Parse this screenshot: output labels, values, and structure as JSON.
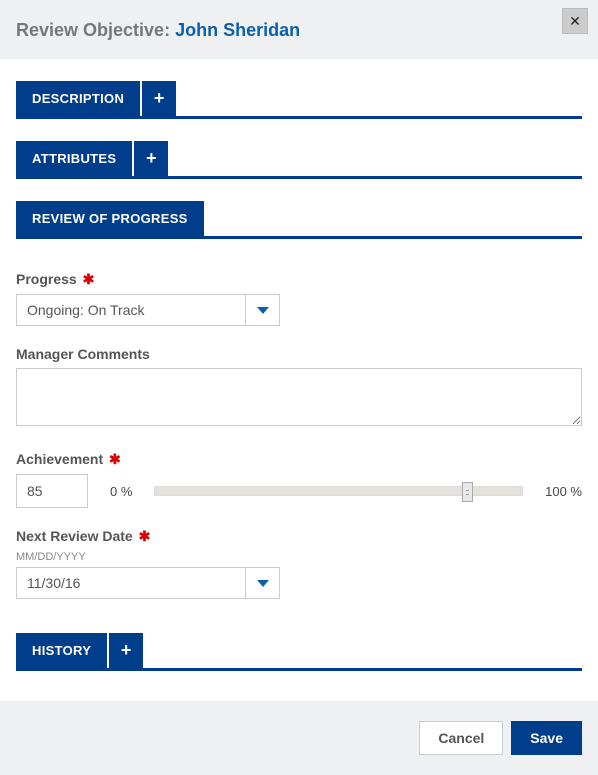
{
  "header": {
    "title_prefix": "Review Objective: ",
    "title_link": "John Sheridan"
  },
  "sections": {
    "description_label": "DESCRIPTION",
    "attributes_label": "ATTRIBUTES",
    "review_label": "REVIEW OF PROGRESS",
    "history_label": "HISTORY"
  },
  "form": {
    "progress_label": "Progress",
    "progress_value": "Ongoing: On Track",
    "manager_comments_label": "Manager Comments",
    "manager_comments_value": "",
    "achievement_label": "Achievement",
    "achievement_value": "85",
    "pct_min_label": "0 %",
    "pct_max_label": "100 %",
    "next_review_label": "Next Review Date",
    "date_hint": "MM/DD/YYYY",
    "next_review_value": "11/30/16"
  },
  "footer": {
    "cancel_label": "Cancel",
    "save_label": "Save"
  },
  "slider_percent": 85
}
